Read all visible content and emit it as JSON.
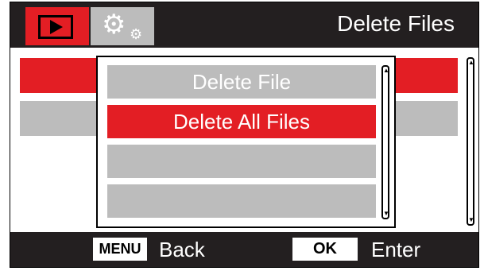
{
  "header": {
    "title": "Delete Files",
    "tabs": [
      {
        "icon": "playback-icon",
        "active": true
      },
      {
        "icon": "settings-gears-icon",
        "active": false
      }
    ]
  },
  "popup": {
    "items": [
      {
        "label": "Delete File",
        "selected": false
      },
      {
        "label": "Delete All Files",
        "selected": true
      },
      {
        "label": "",
        "selected": false
      },
      {
        "label": "",
        "selected": false
      }
    ]
  },
  "footer": {
    "menu_key": "MENU",
    "menu_action": "Back",
    "ok_key": "OK",
    "ok_action": "Enter"
  },
  "colors": {
    "bar": "#231f20",
    "accent_red": "#e31e24",
    "item_gray": "#bcbcbc",
    "text_white": "#ffffff"
  }
}
